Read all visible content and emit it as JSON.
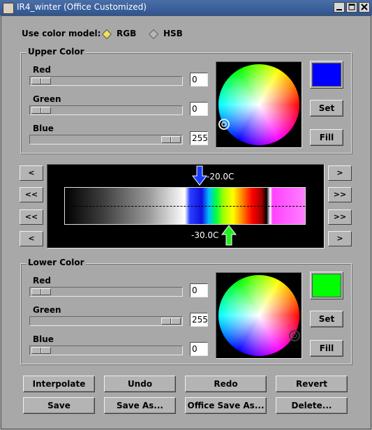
{
  "window": {
    "title": "IR4_winter (Office Customized)"
  },
  "color_model": {
    "label": "Use color model:",
    "options": [
      "RGB",
      "HSB"
    ],
    "selected": "RGB"
  },
  "upper": {
    "title": "Upper Color",
    "red": {
      "label": "Red",
      "value": "0"
    },
    "green": {
      "label": "Green",
      "value": "0"
    },
    "blue": {
      "label": "Blue",
      "value": "255"
    },
    "swatch_color": "#0000ff",
    "set_label": "Set",
    "fill_label": "Fill"
  },
  "lower": {
    "title": "Lower Color",
    "red": {
      "label": "Red",
      "value": "0"
    },
    "green": {
      "label": "Green",
      "value": "255"
    },
    "blue": {
      "label": "Blue",
      "value": "0"
    },
    "swatch_color": "#00ff00",
    "set_label": "Set",
    "fill_label": "Fill"
  },
  "scale": {
    "upper_marker_label": "-20.0C",
    "lower_marker_label": "-30.0C",
    "nav_left": [
      "<",
      "<<",
      "<<",
      "<"
    ],
    "nav_right": [
      ">",
      ">>",
      ">>",
      ">"
    ]
  },
  "buttons": {
    "interpolate": "Interpolate",
    "undo": "Undo",
    "redo": "Redo",
    "revert": "Revert",
    "save": "Save",
    "save_as": "Save As...",
    "office_save_as": "Office Save As...",
    "delete": "Delete..."
  },
  "icons": {
    "window_controls": [
      "minimize-icon",
      "maximize-icon",
      "close-icon"
    ],
    "wheel_cursor": "target-ring-icon",
    "upper_marker": "down-arrow-icon",
    "lower_marker": "up-arrow-icon"
  }
}
